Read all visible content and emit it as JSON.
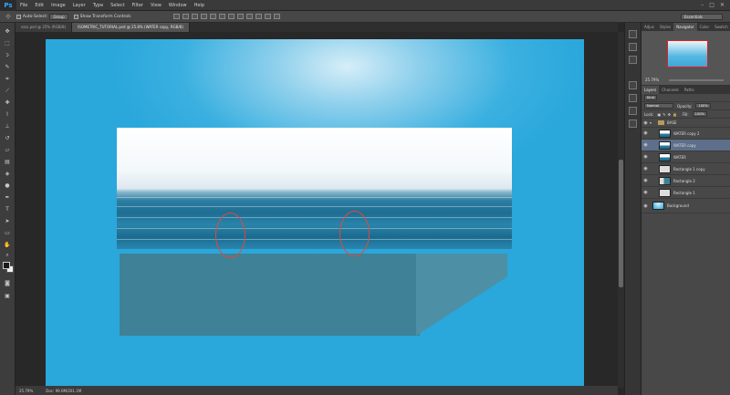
{
  "app": {
    "logo": "Ps",
    "menu": [
      "File",
      "Edit",
      "Image",
      "Layer",
      "Type",
      "Select",
      "Filter",
      "View",
      "Window",
      "Help"
    ],
    "window_controls": [
      "–",
      "□",
      "✕"
    ]
  },
  "options_bar": {
    "tool_glyph": "⊹",
    "auto_select_label": "Auto-Select:",
    "auto_select_value": "Group",
    "transform_controls_label": "Show Transform Controls",
    "workspace": "Essentials"
  },
  "tabs": [
    {
      "label": "ssss.psd @ 25% (RGB/8)",
      "active": false
    },
    {
      "label": "ISOMETRIC_TUTORIAL.psd @ 25.8% (WATER copy, RGB/8)",
      "active": true
    }
  ],
  "status": {
    "zoom": "25.79%",
    "doc": "Doc: 99.0M/201.1M"
  },
  "right_panels": {
    "top_tabs": [
      "Adjus",
      "Styles",
      "Navigator",
      "Color",
      "Swatch"
    ],
    "active_top_tab": "Navigator",
    "navigator_zoom": "25.79%",
    "layer_tabs": [
      "Layers",
      "Channels",
      "Paths"
    ],
    "active_layer_tab": "Layers",
    "kind_label": "Kind",
    "blend_mode": "Normal",
    "opacity_label": "Opacity:",
    "opacity_value": "100%",
    "lock_label": "Lock:",
    "fill_label": "Fill:",
    "fill_value": "100%"
  },
  "layers": [
    {
      "name": "BASE",
      "type": "group"
    },
    {
      "name": "WATER copy 2",
      "type": "layer",
      "selected": false,
      "thumb": "water"
    },
    {
      "name": "WATER copy",
      "type": "layer",
      "selected": true,
      "thumb": "water"
    },
    {
      "name": "WATER",
      "type": "layer",
      "selected": false,
      "thumb": "water"
    },
    {
      "name": "Rectangle 1 copy",
      "type": "layer",
      "selected": false,
      "thumb": "rect"
    },
    {
      "name": "Rectangle 2",
      "type": "layer",
      "selected": false,
      "thumb": "rect2"
    },
    {
      "name": "Rectangle 1",
      "type": "layer",
      "selected": false,
      "thumb": "rect"
    },
    {
      "name": "Background",
      "type": "layer",
      "selected": false,
      "thumb": "bg"
    }
  ],
  "colors": {
    "accent": "#31a8ff",
    "canvas_blue": "#2aa7db",
    "box_front": "#3f8196",
    "box_side": "#4d90a5",
    "highlight_ring": "#e04a3c"
  }
}
